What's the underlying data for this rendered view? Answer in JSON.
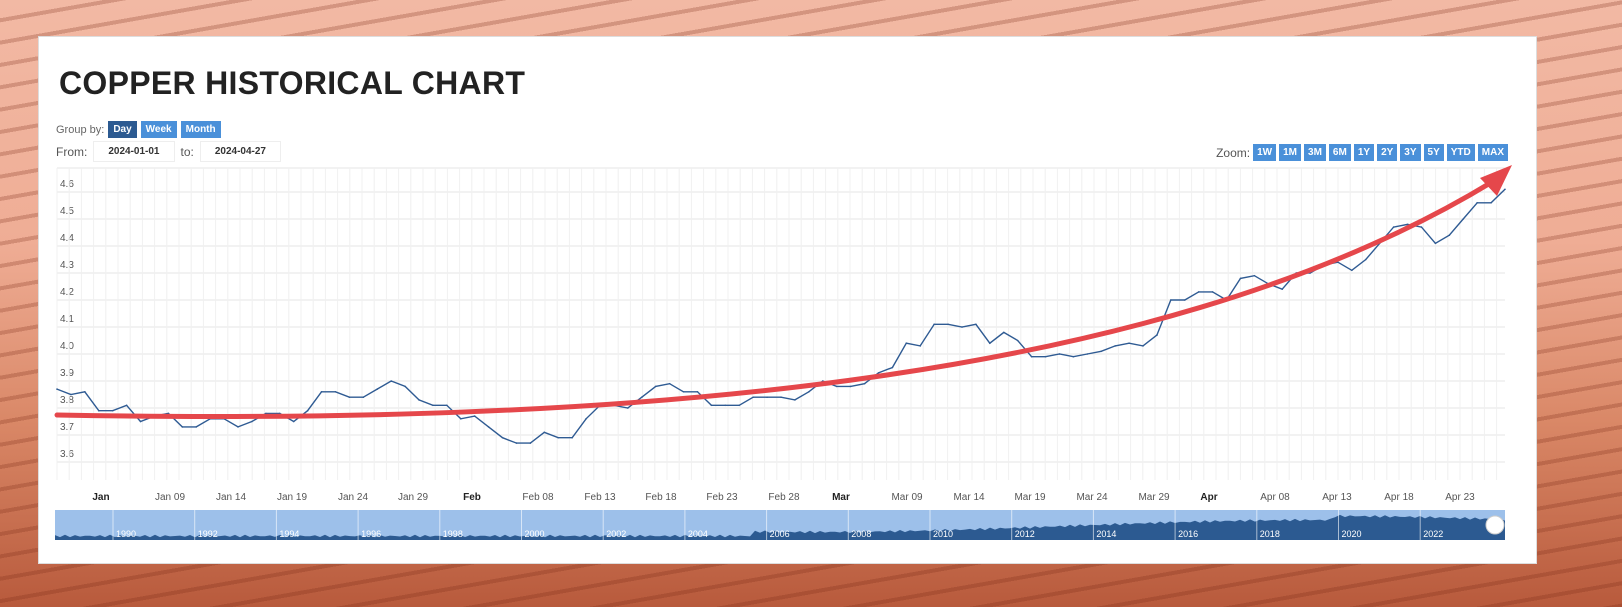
{
  "header": {
    "title": "COPPER HISTORICAL CHART"
  },
  "controls": {
    "group_by_label": "Group by:",
    "group_by": [
      "Day",
      "Week",
      "Month"
    ],
    "group_by_selected": "Day",
    "from_label": "From:",
    "from_value": "2024-01-01",
    "to_label": "to:",
    "to_value": "2024-04-27",
    "zoom_label": "Zoom:",
    "zoom_buttons": [
      "1W",
      "1M",
      "3M",
      "6M",
      "1Y",
      "2Y",
      "3Y",
      "5Y",
      "YTD",
      "MAX"
    ]
  },
  "colors": {
    "line": "#2f5b93",
    "trend_arrow": "#e5474b",
    "navigator_fill": "#9dc0ea",
    "navigator_series": "#2c5a91",
    "button": "#4a90d9",
    "button_active": "#2c5a91"
  },
  "chart_data": {
    "type": "line",
    "title": "COPPER HISTORICAL CHART",
    "ylim": [
      3.55,
      4.7
    ],
    "y_ticks": [
      "3.6",
      "3.7",
      "3.8",
      "3.9",
      "4.0",
      "4.1",
      "4.2",
      "4.3",
      "4.4",
      "4.5",
      "4.6"
    ],
    "x_range": [
      "2024-01-01",
      "2024-04-27"
    ],
    "x_ticks": [
      "Jan",
      "Jan 09",
      "Jan 14",
      "Jan 19",
      "Jan 24",
      "Jan 29",
      "Feb",
      "Feb 08",
      "Feb 13",
      "Feb 18",
      "Feb 23",
      "Feb 28",
      "Mar",
      "Mar 09",
      "Mar 14",
      "Mar 19",
      "Mar 24",
      "Mar 29",
      "Apr",
      "Apr 08",
      "Apr 13",
      "Apr 18",
      "Apr 23"
    ],
    "x_ticks_bold": [
      "Jan",
      "Feb",
      "Mar",
      "Apr"
    ],
    "grid": true,
    "values": [
      3.87,
      3.85,
      3.86,
      3.79,
      3.79,
      3.81,
      3.75,
      3.77,
      3.78,
      3.73,
      3.73,
      3.76,
      3.76,
      3.73,
      3.75,
      3.78,
      3.78,
      3.75,
      3.79,
      3.86,
      3.86,
      3.84,
      3.84,
      3.87,
      3.9,
      3.88,
      3.83,
      3.81,
      3.81,
      3.76,
      3.77,
      3.73,
      3.69,
      3.67,
      3.67,
      3.71,
      3.69,
      3.69,
      3.76,
      3.81,
      3.81,
      3.8,
      3.84,
      3.88,
      3.89,
      3.86,
      3.86,
      3.81,
      3.81,
      3.81,
      3.84,
      3.84,
      3.84,
      3.83,
      3.86,
      3.9,
      3.88,
      3.88,
      3.89,
      3.93,
      3.95,
      4.04,
      4.03,
      4.11,
      4.11,
      4.1,
      4.11,
      4.04,
      4.08,
      4.05,
      3.99,
      3.99,
      4.0,
      3.99,
      4.0,
      4.01,
      4.03,
      4.04,
      4.03,
      4.07,
      4.2,
      4.2,
      4.23,
      4.23,
      4.2,
      4.28,
      4.29,
      4.26,
      4.24,
      4.3,
      4.3,
      4.33,
      4.34,
      4.31,
      4.35,
      4.41,
      4.47,
      4.48,
      4.47,
      4.41,
      4.44,
      4.5,
      4.56,
      4.56,
      4.61
    ],
    "annotation": "upward trend arrow",
    "navigator": {
      "x_ticks": [
        "1990",
        "1992",
        "1994",
        "1996",
        "1998",
        "2000",
        "2002",
        "2004",
        "2006",
        "2008",
        "2010",
        "2012",
        "2014",
        "2016",
        "2018",
        "2020",
        "2022"
      ]
    }
  }
}
